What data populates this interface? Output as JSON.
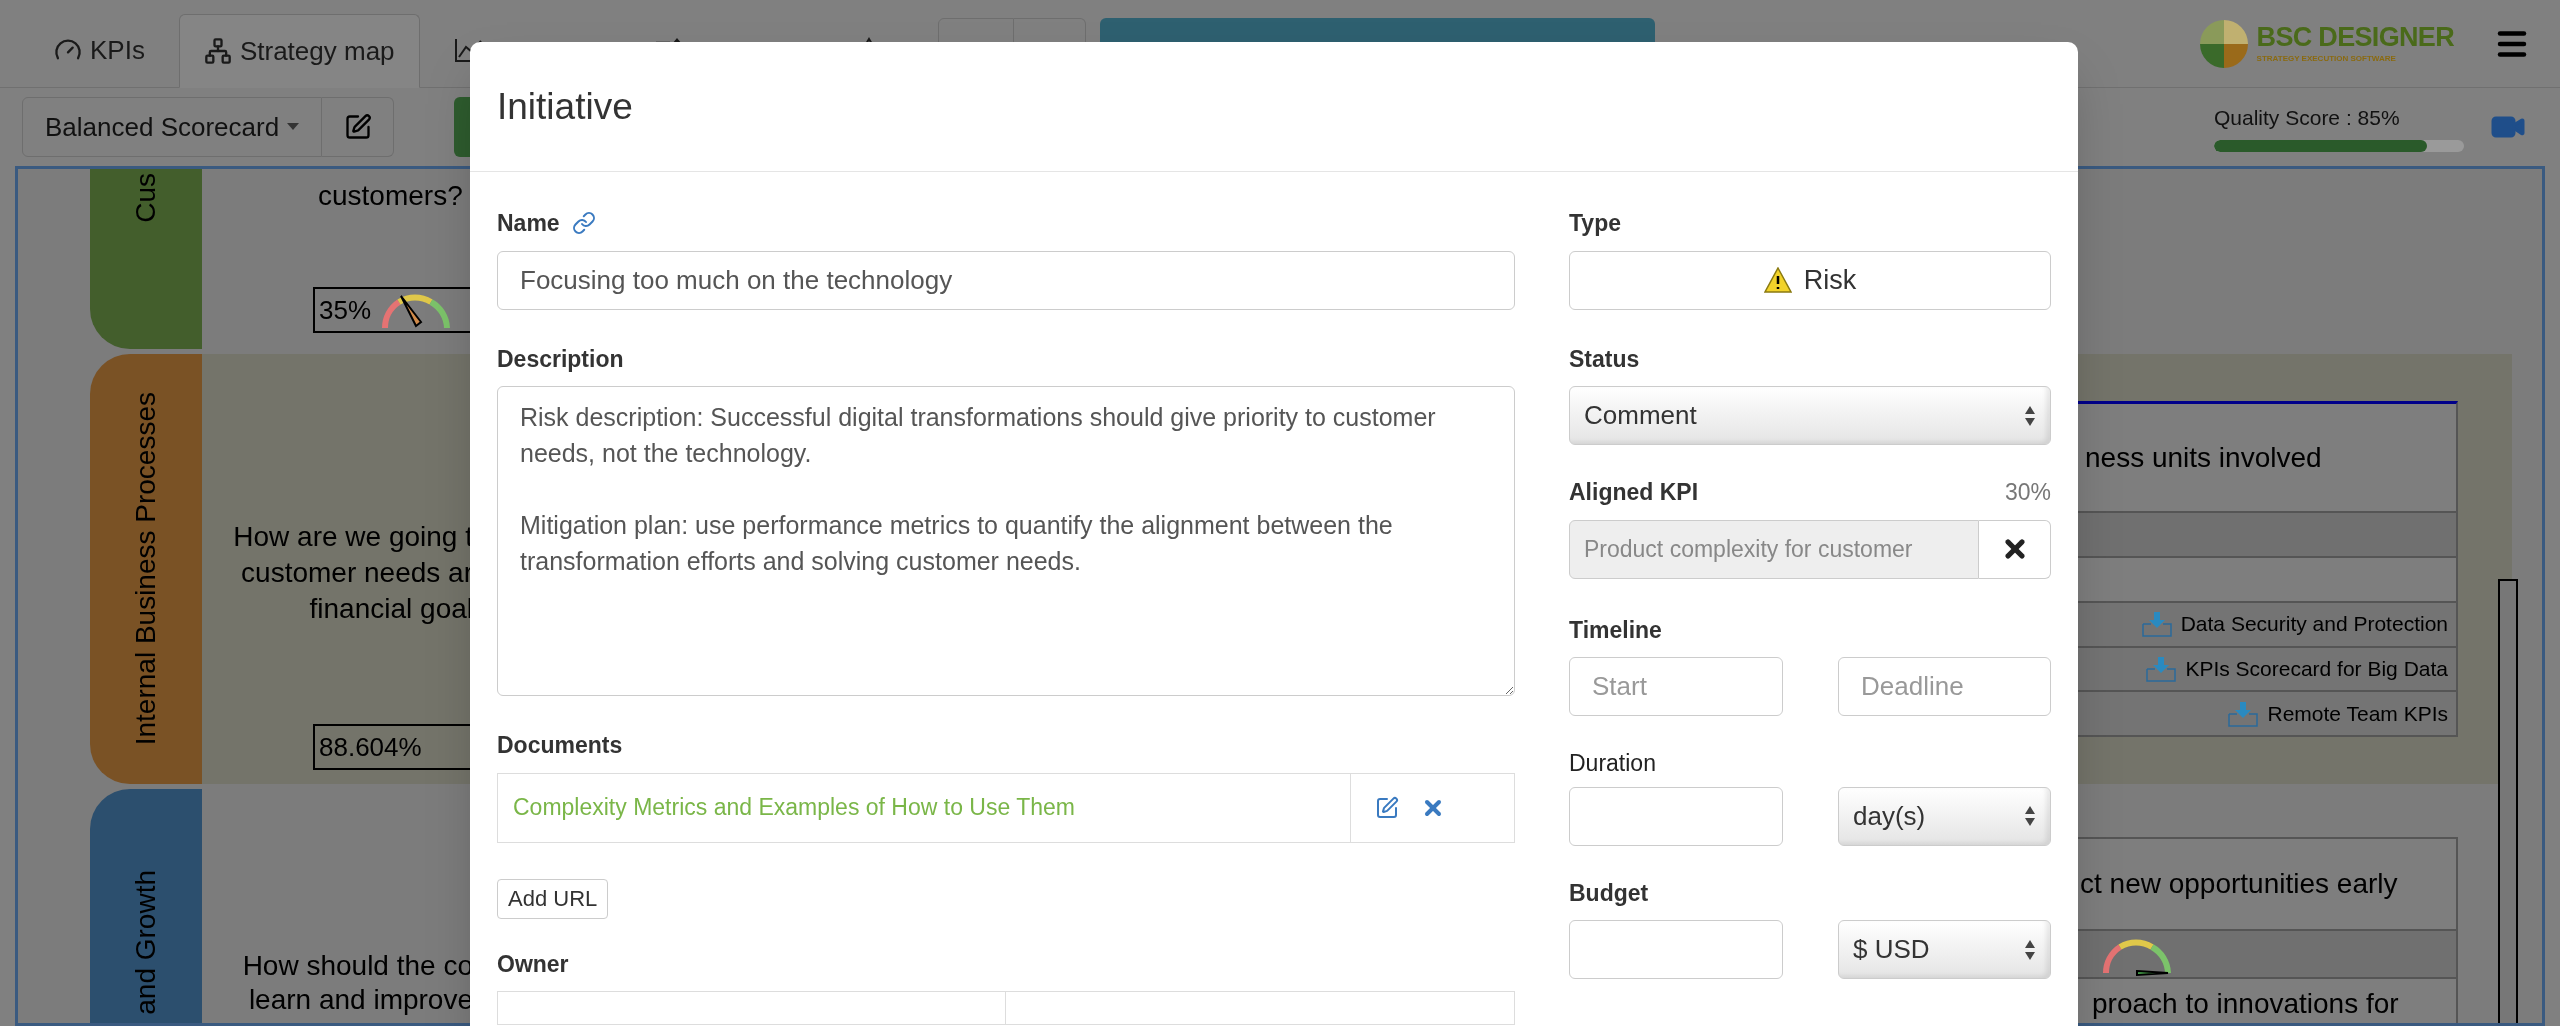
{
  "tabs": [
    {
      "label": "KPIs",
      "selected": false
    },
    {
      "label": "Strategy map",
      "selected": true
    }
  ],
  "toolbar": {
    "scorecard": "Balanced Scorecard"
  },
  "logo": {
    "title": "BSC DESIGNER",
    "subtitle": "STRATEGY EXECUTION SOFTWARE"
  },
  "quality": {
    "label": "Quality Score : 85%",
    "level": 0.85
  },
  "lanes": [
    {
      "label": "Cus",
      "color": "#435e2c"
    },
    {
      "label": "Internal Business Processes",
      "color": "#7a5225"
    },
    {
      "label": "and Growth",
      "color": "#2c4f6e"
    }
  ],
  "map_left": {
    "question_1": "customers?",
    "gauge_1": "35%",
    "question_2": [
      "How are we going t",
      "customer needs ar",
      "financial goal"
    ],
    "gauge_2": "88.604%",
    "question_3": [
      "How should the co",
      "learn and improve"
    ]
  },
  "map_right": {
    "goal_1": "ness units involved",
    "rows": [
      "Data Security and Protection",
      "KPIs Scorecard for Big Data",
      "Remote Team KPIs"
    ],
    "goal_2": "ct new opportunities early",
    "goal_2_text": "proach to innovations for"
  },
  "modal": {
    "title": "Initiative",
    "name": {
      "label": "Name",
      "value": "Focusing too much on the technology"
    },
    "description": {
      "label": "Description",
      "value": "Risk description: Successful digital transformations should give priority to customer needs, not the technology.\n\nMitigation plan: use performance metrics to quantify the alignment between the transformation efforts and solving customer needs."
    },
    "documents": {
      "label": "Documents",
      "items": [
        {
          "title": "Complexity Metrics and Examples of How to Use Them"
        }
      ]
    },
    "add_url": "Add URL",
    "owner": {
      "label": "Owner"
    },
    "type": {
      "label": "Type",
      "value": "Risk"
    },
    "status": {
      "label": "Status",
      "value": "Comment"
    },
    "aligned_kpi": {
      "label": "Aligned KPI",
      "percent": "30%",
      "value": "Product complexity for customer",
      "disabled": true
    },
    "timeline": {
      "label": "Timeline",
      "start_placeholder": "Start",
      "deadline_placeholder": "Deadline"
    },
    "duration": {
      "label": "Duration",
      "unit": "day(s)"
    },
    "budget": {
      "label": "Budget",
      "currency": "$ USD"
    }
  }
}
